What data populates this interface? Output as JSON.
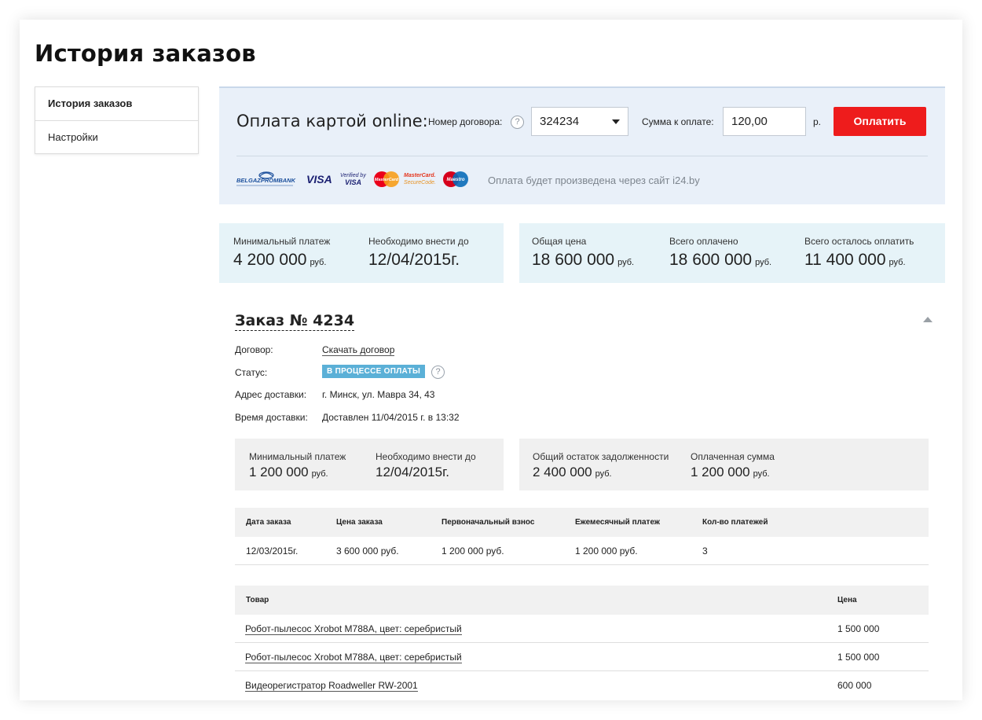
{
  "page": {
    "title": "История заказов"
  },
  "sidebar": {
    "items": [
      {
        "label": "История заказов",
        "active": true
      },
      {
        "label": "Настройки",
        "active": false
      }
    ]
  },
  "payment": {
    "title": "Оплата картой online:",
    "contract_label": "Номер договора:",
    "contract_value": "324234",
    "sum_label": "Сумма к оплате:",
    "sum_value": "120,00",
    "currency": "р.",
    "button_label": "Оплатить",
    "note": "Оплата будет произведена через сайт i24.by",
    "help_glyph": "?",
    "logos": {
      "belgazprombank": "BELGAZPROMBANK",
      "visa": "VISA",
      "verified_visa_line1": "Verified by",
      "verified_visa_line2": "VISA",
      "mastercard": "MasterCard",
      "mc_secure_line1": "MasterCard.",
      "mc_secure_line2": "SecureCode.",
      "maestro": "Maestro"
    },
    "colors": {
      "button": "#ee1c1c",
      "panel": "#e9f0f9"
    }
  },
  "summary_top": {
    "left": [
      {
        "label": "Минимальный платеж",
        "value": "4 200 000",
        "unit": "руб."
      },
      {
        "label": "Необходимо внести до",
        "value": "12/04/2015г.",
        "unit": ""
      }
    ],
    "right": [
      {
        "label": "Общая цена",
        "value": "18 600 000",
        "unit": "руб."
      },
      {
        "label": "Всего оплачено",
        "value": "18 600 000",
        "unit": "руб."
      },
      {
        "label": "Всего осталось оплатить",
        "value": "11 400 000",
        "unit": "руб."
      }
    ]
  },
  "order": {
    "title": "Заказ № 4234",
    "fields": {
      "contract_key": "Договор:",
      "contract_link": "Скачать договор",
      "status_key": "Статус:",
      "status_value": "В ПРОЦЕССЕ ОПЛАТЫ",
      "address_key": "Адрес доставки:",
      "address_value": "г. Минск, ул. Мавра 34, 43",
      "time_key": "Время доставки:",
      "time_value": "Доставлен 11/04/2015 г. в 13:32"
    },
    "summary": {
      "left": [
        {
          "label": "Минимальный платеж",
          "value": "1 200 000",
          "unit": "руб."
        },
        {
          "label": "Необходимо внести до",
          "value": "12/04/2015г.",
          "unit": ""
        }
      ],
      "right": [
        {
          "label": "Общий остаток задолженности",
          "value": "2 400 000",
          "unit": "руб."
        },
        {
          "label": "Оплаченная сумма",
          "value": "1 200 000",
          "unit": "руб."
        }
      ]
    },
    "details_table": {
      "headers": [
        "Дата заказа",
        "Цена заказа",
        "Первоначальный взнос",
        "Ежемесячный платеж",
        "Кол-во платежей"
      ],
      "row": [
        "12/03/2015г.",
        "3 600 000 руб.",
        "1 200 000 руб.",
        "1 200 000 руб.",
        "3"
      ]
    },
    "items_table": {
      "headers": [
        "Товар",
        "Цена"
      ],
      "rows": [
        {
          "name": "Робот-пылесос Xrobot M788A, цвет: серебристый",
          "price": "1 500 000"
        },
        {
          "name": "Робот-пылесос Xrobot M788A, цвет: серебристый",
          "price": "1 500 000"
        },
        {
          "name": "Видеорегистратор Roadweller RW-2001",
          "price": "600 000"
        }
      ]
    },
    "status_color": "#5bb0d7"
  }
}
